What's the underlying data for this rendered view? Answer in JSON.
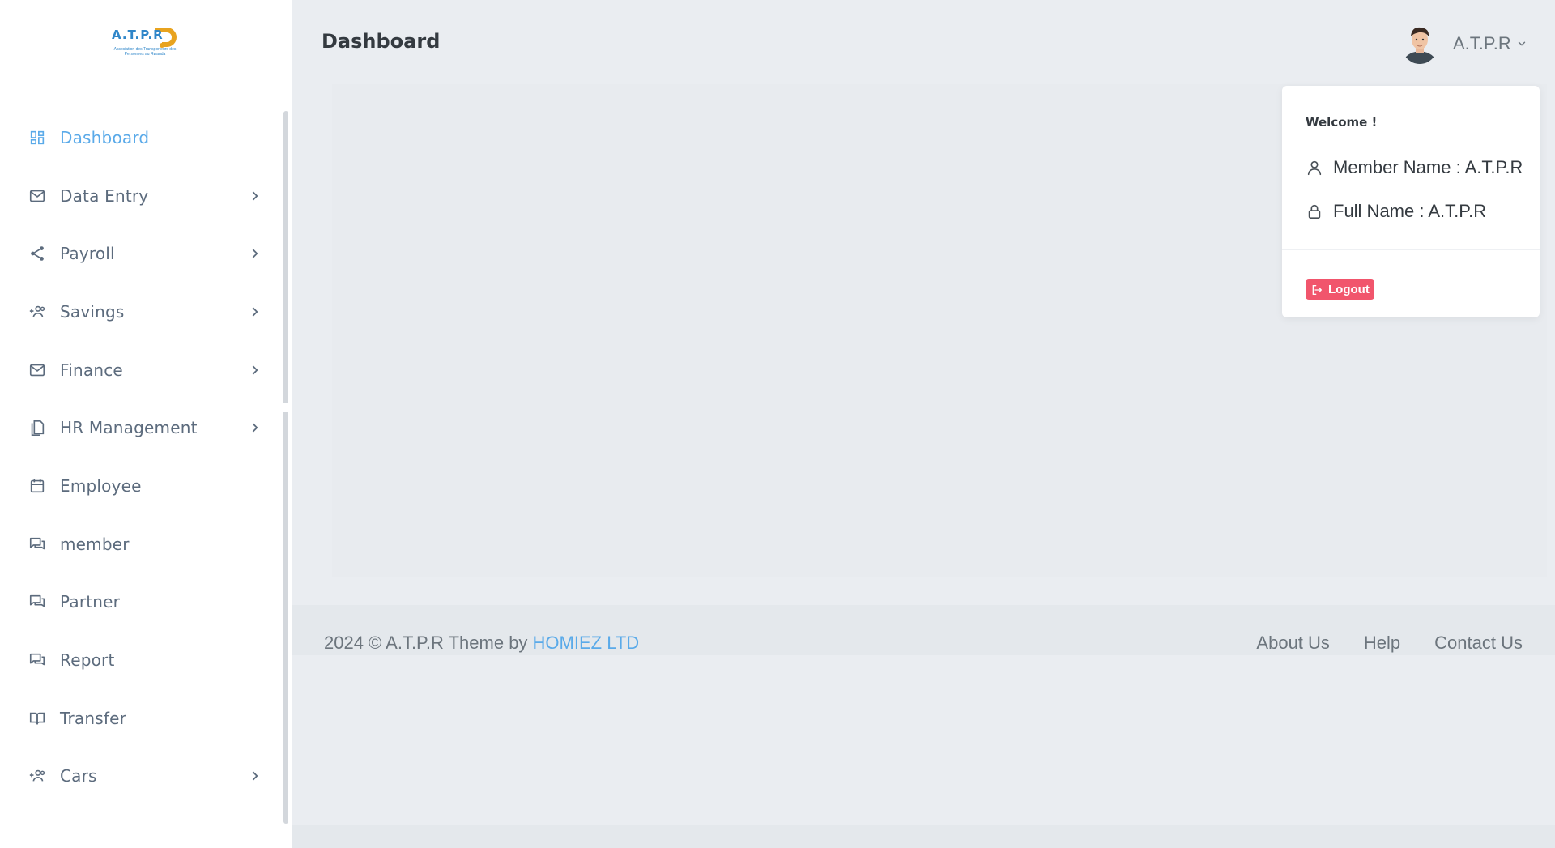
{
  "brand": {
    "logo_text": "A.T.P.R",
    "logo_subtext": "Association des Transporteurs des Personnes au Rwanda"
  },
  "sidebar": {
    "items": [
      {
        "label": "Dashboard",
        "icon": "dashboard-icon",
        "active": true,
        "submenu": false
      },
      {
        "label": "Data Entry",
        "icon": "mail-icon",
        "active": false,
        "submenu": true
      },
      {
        "label": "Payroll",
        "icon": "share-icon",
        "active": false,
        "submenu": true
      },
      {
        "label": "Savings",
        "icon": "user-add-icon",
        "active": false,
        "submenu": true
      },
      {
        "label": "Finance",
        "icon": "mail-icon",
        "active": false,
        "submenu": true
      },
      {
        "label": "HR Management",
        "icon": "copy-icon",
        "active": false,
        "submenu": true
      },
      {
        "label": "Employee",
        "icon": "calendar-icon",
        "active": false,
        "submenu": false
      },
      {
        "label": "member",
        "icon": "chat-icon",
        "active": false,
        "submenu": false
      },
      {
        "label": "Partner",
        "icon": "chat-icon",
        "active": false,
        "submenu": false
      },
      {
        "label": "Report",
        "icon": "chat-icon",
        "active": false,
        "submenu": false
      },
      {
        "label": "Transfer",
        "icon": "book-icon",
        "active": false,
        "submenu": false
      },
      {
        "label": "Cars",
        "icon": "user-add-icon",
        "active": false,
        "submenu": true
      }
    ]
  },
  "header": {
    "title": "Dashboard",
    "user_name": "A.T.P.R"
  },
  "user_menu": {
    "welcome": "Welcome !",
    "member_name": "Member Name : A.T.P.R",
    "full_name": "Full Name : A.T.P.R",
    "logout_label": "Logout"
  },
  "footer": {
    "copyright": "2024 © A.T.P.R Theme by ",
    "company_link": "HOMIEZ LTD",
    "links": [
      "About Us",
      "Help",
      "Contact Us"
    ]
  },
  "colors": {
    "accent": "#5aaae9",
    "danger": "#f1556c",
    "background": "#eaedf1",
    "sidebar": "#ffffff"
  }
}
